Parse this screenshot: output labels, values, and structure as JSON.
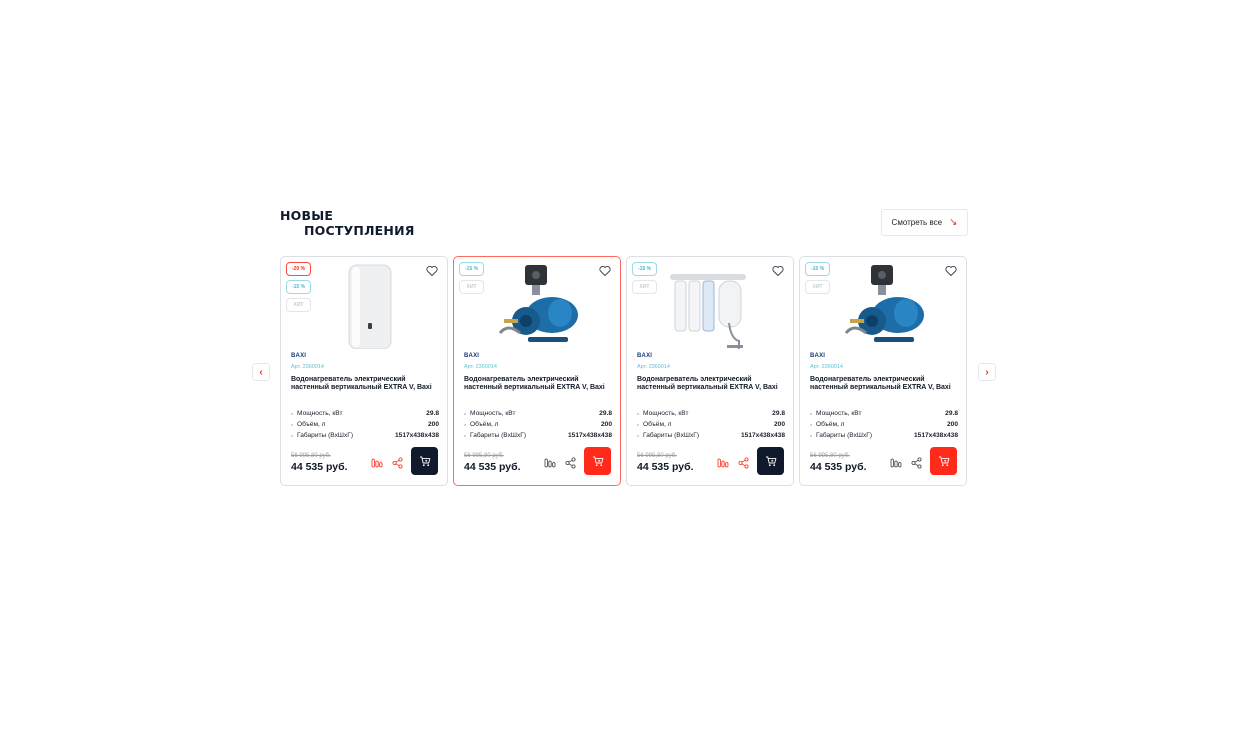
{
  "section": {
    "title_line1": "НОВЫЕ",
    "title_line2": "ПОСТУПЛЕНИЯ",
    "see_all": "Смотреть все"
  },
  "products": [
    {
      "badges": [
        {
          "label": "-20 %",
          "style": "red"
        },
        {
          "label": "-15 %",
          "style": "teal"
        },
        {
          "label": "ХИТ",
          "style": "grey"
        }
      ],
      "image": "water-heater",
      "brand": "BAXI",
      "sku": "Арт. 2360014",
      "title": "Водонагреватель электрический настенный вертикальный EXTRA V, Baxi",
      "specs": [
        {
          "k": "Мощность, кВт",
          "v": "29.8"
        },
        {
          "k": "Объём, л",
          "v": "200"
        },
        {
          "k": "Габариты (ВхШхГ)",
          "v": "1517x438x438"
        }
      ],
      "old_price": "56 995,80 руб.",
      "price": "44 535 руб.",
      "compare_active": true,
      "cart_style": "dark",
      "highlighted": false
    },
    {
      "badges": [
        {
          "label": "-15 %",
          "style": "teal"
        },
        {
          "label": "ХИТ",
          "style": "grey"
        }
      ],
      "image": "water-pump",
      "brand": "BAXI",
      "sku": "Арт. 2360014",
      "title": "Водонагреватель электрический настенный вертикальный EXTRA V, Baxi",
      "specs": [
        {
          "k": "Мощность, кВт",
          "v": "29.8"
        },
        {
          "k": "Объём, л",
          "v": "200"
        },
        {
          "k": "Габариты (ВхШхГ)",
          "v": "1517x438x438"
        }
      ],
      "old_price": "56 995,80 руб.",
      "price": "44 535 руб.",
      "compare_active": false,
      "cart_style": "red",
      "highlighted": true
    },
    {
      "badges": [
        {
          "label": "-15 %",
          "style": "teal"
        },
        {
          "label": "ХИТ",
          "style": "grey"
        }
      ],
      "image": "water-filter",
      "brand": "BAXI",
      "sku": "Арт. 2360014",
      "title": "Водонагреватель электрический настенный вертикальный EXTRA V, Baxi",
      "specs": [
        {
          "k": "Мощность, кВт",
          "v": "29.8"
        },
        {
          "k": "Объём, л",
          "v": "200"
        },
        {
          "k": "Габариты (ВхШхГ)",
          "v": "1517x438x438"
        }
      ],
      "old_price": "56 995,80 руб.",
      "price": "44 535 руб.",
      "compare_active": true,
      "cart_style": "dark",
      "highlighted": false
    },
    {
      "badges": [
        {
          "label": "-15 %",
          "style": "teal"
        },
        {
          "label": "ХИТ",
          "style": "grey"
        }
      ],
      "image": "water-pump",
      "brand": "BAXI",
      "sku": "Арт. 2360014",
      "title": "Водонагреватель электрический настенный вертикальный EXTRA V, Baxi",
      "specs": [
        {
          "k": "Мощность, кВт",
          "v": "29.8"
        },
        {
          "k": "Объём, л",
          "v": "200"
        },
        {
          "k": "Габариты (ВхШхГ)",
          "v": "1517x438x438"
        }
      ],
      "old_price": "56 995,80 руб.",
      "price": "44 535 руб.",
      "compare_active": false,
      "cart_style": "red",
      "highlighted": false
    }
  ],
  "colors": {
    "accent": "#ff2a1a",
    "dark": "#111a2c",
    "teal": "#4ab6cf",
    "brand_blue": "#163a7a"
  }
}
